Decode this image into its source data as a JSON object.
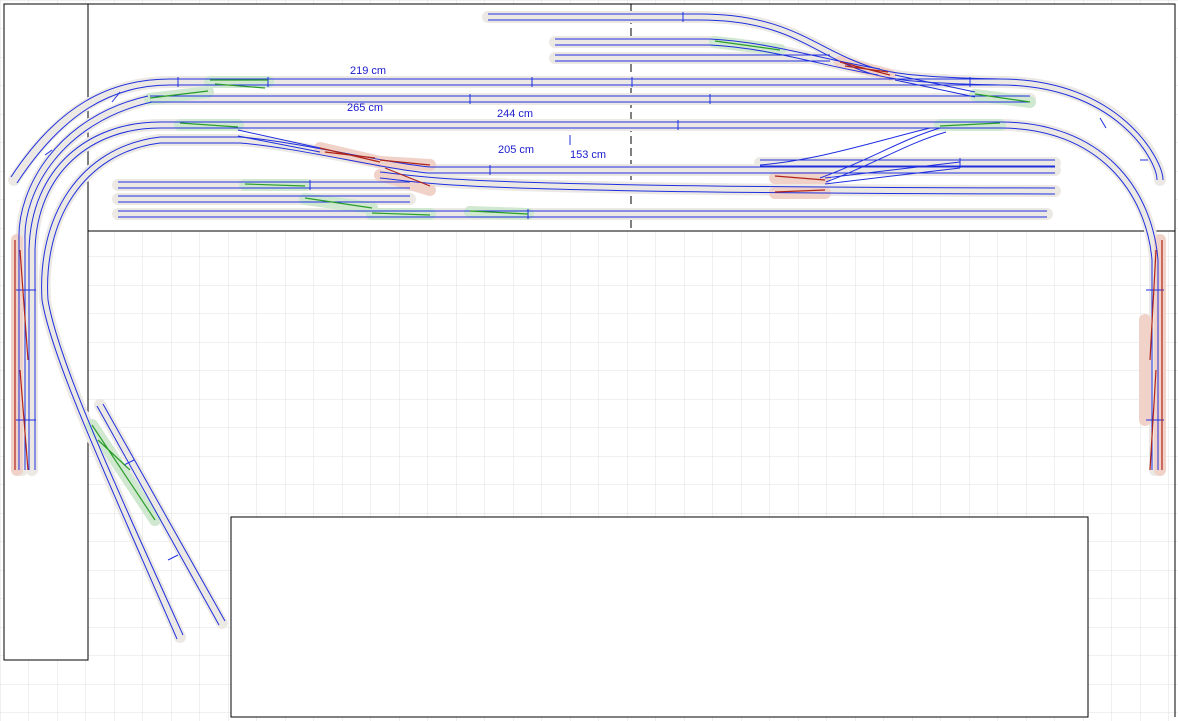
{
  "colors": {
    "background": "#ffffff",
    "grid": "#e0e0e0",
    "board_outline": "#000000",
    "track_bed": "#ece9e4",
    "rail": "#1f2fe0",
    "turnout_green": "#2a9d2a",
    "turnout_green_bed": "#cfe8cf",
    "turnout_red": "#b0251a",
    "turnout_red_bed": "#f0d2c8",
    "dimension_text": "#1a1acc"
  },
  "dimensions": [
    {
      "id": "dim-219",
      "text": "219 cm"
    },
    {
      "id": "dim-265",
      "text": "265 cm"
    },
    {
      "id": "dim-244",
      "text": "244 cm"
    },
    {
      "id": "dim-205",
      "text": "205 cm"
    },
    {
      "id": "dim-153",
      "text": "153 cm"
    }
  ]
}
